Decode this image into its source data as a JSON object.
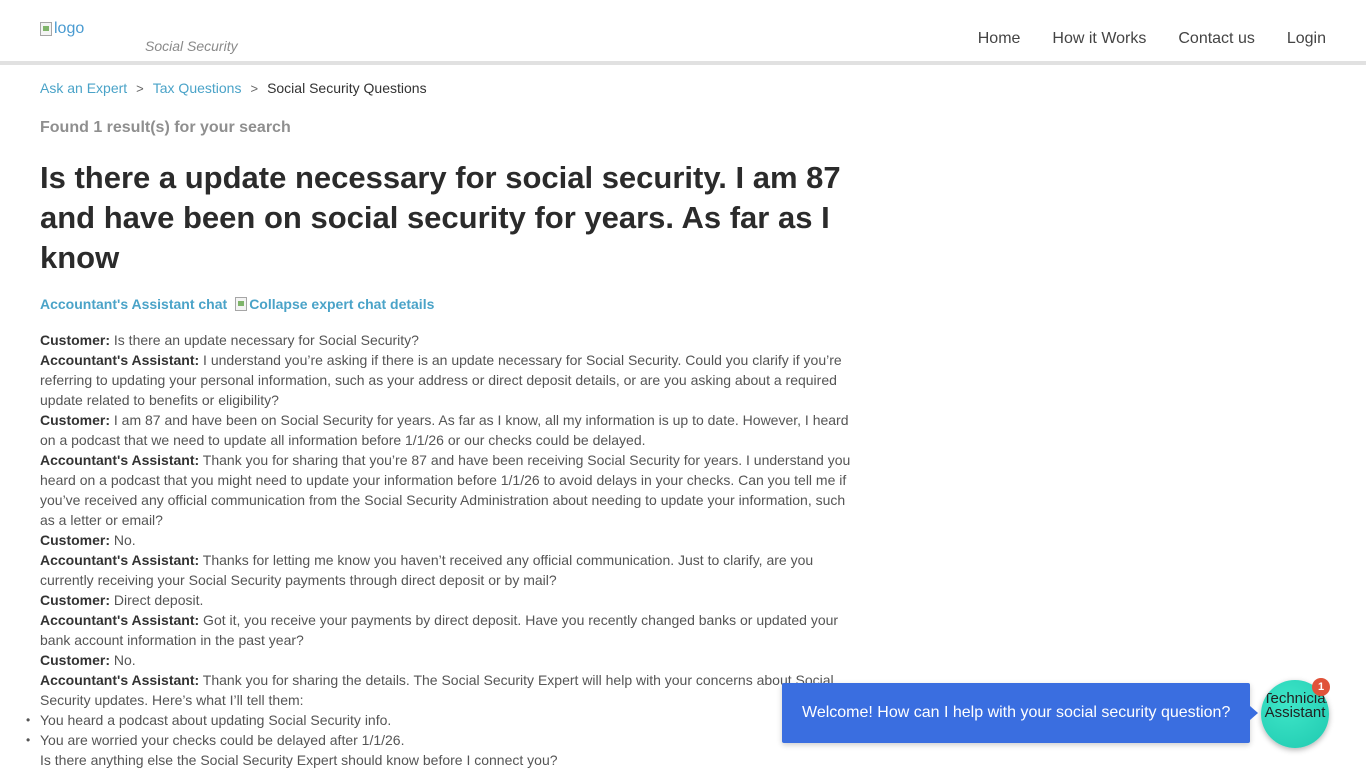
{
  "header": {
    "logo_alt": "logo",
    "logo_subtitle": "Social Security",
    "nav": [
      "Home",
      "How it Works",
      "Contact us",
      "Login"
    ]
  },
  "breadcrumb": [
    "Ask an Expert",
    "Tax Questions",
    "Social Security Questions"
  ],
  "results_text": "Found 1 result(s) for your search",
  "question_title": "Is there a update necessary for social security. I am 87 and have been on social security for years. As far as I know",
  "chat_toggle": {
    "label": "Accountant's Assistant chat",
    "collapse_alt": "Collapse expert chat details"
  },
  "transcript": [
    {
      "speaker": "Customer:",
      "text": " Is there an update necessary for Social Security?"
    },
    {
      "speaker": "Accountant's Assistant:",
      "text": " I understand you’re asking if there is an update necessary for Social Security. Could you clarify if you’re referring to updating your personal information, such as your address or direct deposit details, or are you asking about a required update related to benefits or eligibility?"
    },
    {
      "speaker": "Customer:",
      "text": " I am 87 and have been on Social Security for years. As far as I know, all my information is up to date. However, I heard on a podcast that we need to update all information before 1/1/26 or our checks could be delayed."
    },
    {
      "speaker": "Accountant's Assistant:",
      "text": " Thank you for sharing that you’re 87 and have been receiving Social Security for years. I understand you heard on a podcast that you might need to update your information before 1/1/26 to avoid delays in your checks. Can you tell me if you’ve received any official communication from the Social Security Administration about needing to update your information, such as a letter or email?"
    },
    {
      "speaker": "Customer:",
      "text": " No."
    },
    {
      "speaker": "Accountant's Assistant:",
      "text": " Thanks for letting me know you haven’t received any official communication. Just to clarify, are you currently receiving your Social Security payments through direct deposit or by mail?"
    },
    {
      "speaker": "Customer:",
      "text": " Direct deposit."
    },
    {
      "speaker": "Accountant's Assistant:",
      "text": " Got it, you receive your payments by direct deposit. Have you recently changed banks or updated your bank account information in the past year?"
    },
    {
      "speaker": "Customer:",
      "text": " No."
    },
    {
      "speaker": "Accountant's Assistant:",
      "text": " Thank you for sharing the details. The Social Security Expert will help with your concerns about Social Security updates. Here’s what I’ll tell them:"
    }
  ],
  "summary_bullets": [
    "You heard a podcast about updating Social Security info.",
    "You are worried your checks could be delayed after 1/1/26."
  ],
  "closing_question": "Is there anything else the Social Security Expert should know before I connect you?",
  "chat_widget": {
    "welcome": "Welcome! How can I help with your social security question?",
    "avatar_alt": "Technician Assistant",
    "badge_count": "1"
  }
}
